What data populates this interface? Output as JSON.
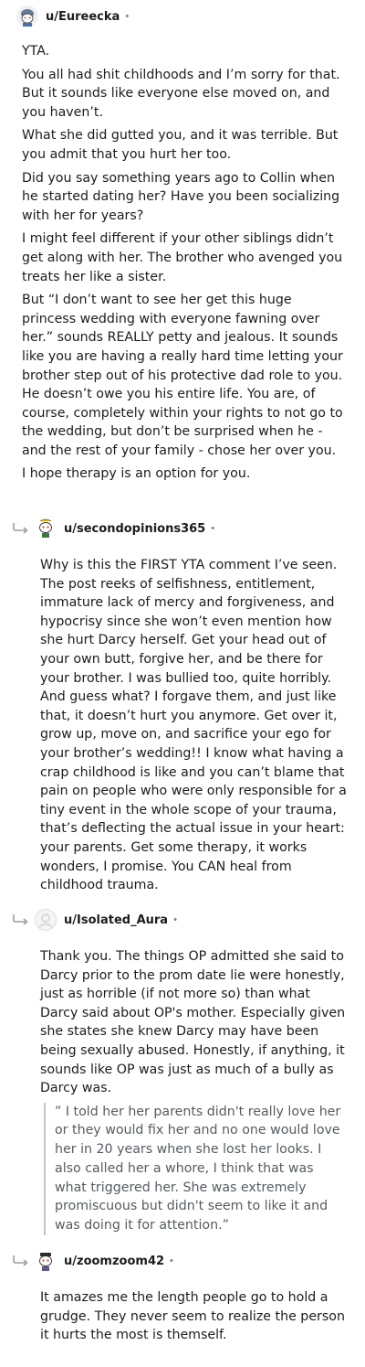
{
  "comments": [
    {
      "username": "u/Eureecka",
      "paragraphs": [
        "YTA.",
        "You all had shit childhoods and I’m sorry for that. But it sounds like everyone else moved on, and you haven’t.",
        "What she did gutted you, and it was terrible. But you admit that you hurt her too.",
        "Did you say something years ago to Collin when he started dating her? Have you been socializing with her for years?",
        "I might feel different if your other siblings didn’t get along with her. The brother who avenged you treats her like a sister.",
        "But “I don’t want to see her get this huge princess wedding with everyone fawning over her.” sounds REALLY petty and jealous. It sounds like you are having a really hard time letting your brother step out of his protective dad role to you. He doesn’t owe you his entire life. You are, of course, completely within your rights to not go to the wedding, but don’t be surprised when he - and the rest of your family - chose her over you.",
        "I hope therapy is an option for you."
      ]
    },
    {
      "username": "u/secondopinions365",
      "paragraphs": [
        "Why is this the FIRST YTA comment I’ve seen. The post reeks of selfishness, entitlement, immature lack of mercy and forgiveness, and hypocrisy since she won’t even mention how she hurt Darcy herself. Get your head out of your own butt, forgive her, and be there for your brother. I was bullied too, quite horribly. And guess what? I forgave them, and just like that, it doesn’t hurt you anymore. Get over it, grow up, move on, and sacrifice your ego for your brother’s wedding!! I know what having a crap childhood is like and you can’t blame that pain on people who were only responsible for a tiny event in the whole scope of your trauma, that’s deflecting the actual issue in your heart: your parents. Get some therapy, it works wonders, I promise. You CAN heal from childhood trauma."
      ]
    },
    {
      "username": "u/Isolated_Aura",
      "paragraphs": [
        "Thank you. The things OP admitted she said to Darcy prior to the prom date lie were honestly, just as horrible (if not more so) than what Darcy said about OP's mother. Especially given she states she knew Darcy may have been being sexually abused. Honestly, if anything, it sounds like OP was just as much of a bully as Darcy was."
      ],
      "quote": "” I told her her parents didn't really love her or they would fix her and no one would love her in 20 years when she lost her looks. I also called her a whore, I think that was what triggered her. She was extremely promiscuous but didn't seem to like it and was doing it for attention.”"
    },
    {
      "username": "u/zoomzoom42",
      "paragraphs": [
        "It amazes me the length people go to hold a grudge. They never seem to realize the person it hurts the most is themself."
      ]
    }
  ],
  "dot": "•",
  "colors": {
    "text": "#1c1c1c",
    "meta": "#7c7c7c",
    "quote_bar": "#c4c4c4",
    "quote_text": "#555c60",
    "reply_arrow": "#9aa0a6"
  }
}
